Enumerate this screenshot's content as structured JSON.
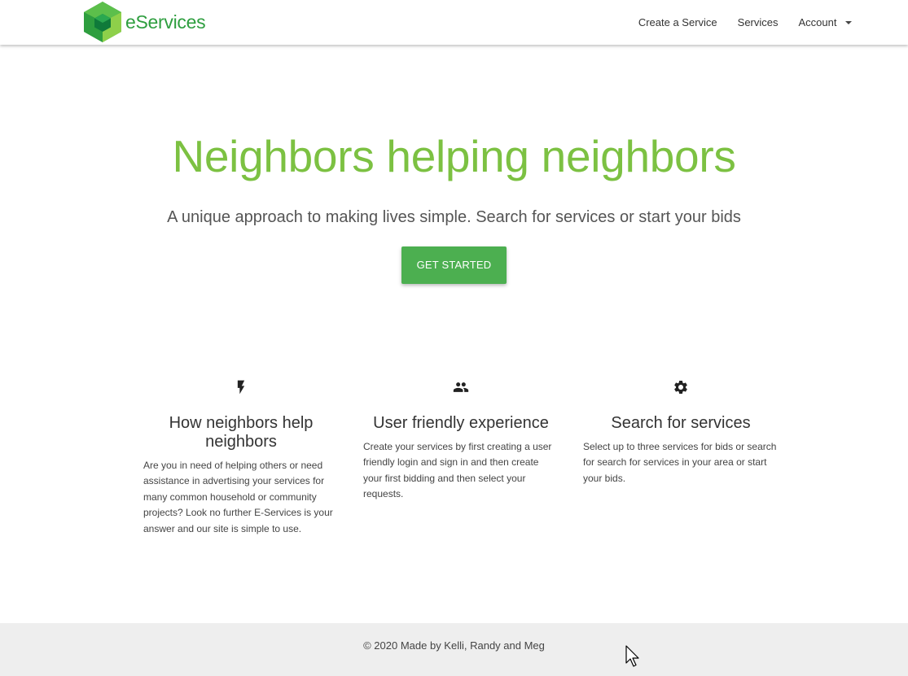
{
  "nav": {
    "brand": "eServices",
    "links": [
      "Create a Service",
      "Services",
      "Account"
    ]
  },
  "hero": {
    "title": "Neighbors helping neighbors",
    "subtitle": "A unique approach to making lives simple. Search for services or start your bids",
    "cta": "Get Started"
  },
  "features": [
    {
      "icon": "flash-icon",
      "title": "How neighbors help neighbors",
      "text": "Are you in need of helping others or need assistance in advertising your services for many common household or community projects? Look no further E-Services is your answer and our site is simple to use."
    },
    {
      "icon": "group-icon",
      "title": "User friendly experience",
      "text": "Create your services by first creating a user friendly login and sign in and then create your first bidding and then select your requests."
    },
    {
      "icon": "settings-icon",
      "title": "Search for services",
      "text": "Select up to three services for bids or search for search for services in your area or start your bids."
    }
  ],
  "footer": {
    "text": "© 2020 Made by Kelli, Randy and Meg"
  },
  "colors": {
    "accent_green": "#4caf50",
    "title_green": "#7cc142",
    "brand_green": "#2e9e3f",
    "footer_bg": "#eeeeee"
  }
}
